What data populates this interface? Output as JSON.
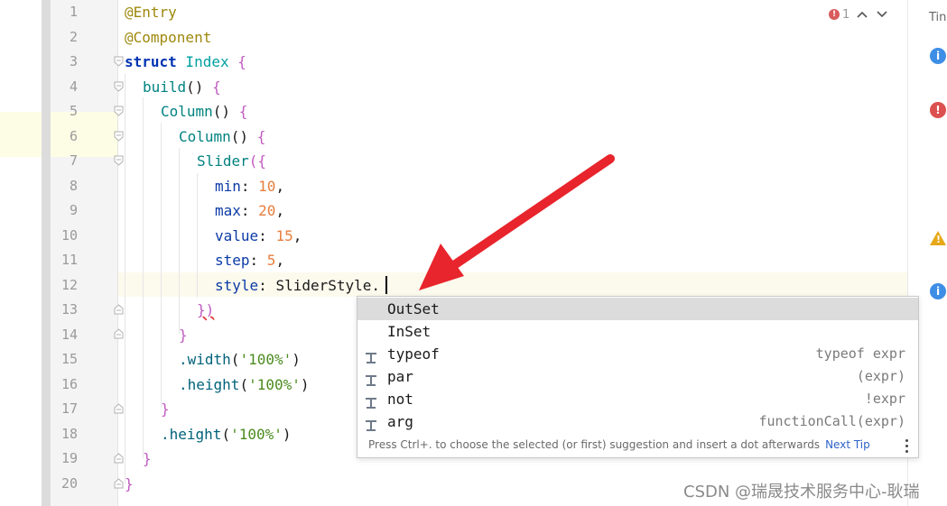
{
  "editor": {
    "lines": [
      {
        "n": "1"
      },
      {
        "n": "2"
      },
      {
        "n": "3"
      },
      {
        "n": "4"
      },
      {
        "n": "5"
      },
      {
        "n": "6"
      },
      {
        "n": "7"
      },
      {
        "n": "8"
      },
      {
        "n": "9"
      },
      {
        "n": "10"
      },
      {
        "n": "11"
      },
      {
        "n": "12"
      },
      {
        "n": "13"
      },
      {
        "n": "14"
      },
      {
        "n": "15"
      },
      {
        "n": "16"
      },
      {
        "n": "17"
      },
      {
        "n": "18"
      },
      {
        "n": "19"
      },
      {
        "n": "20"
      }
    ],
    "code": {
      "l1": "@Entry",
      "l2": "@Component",
      "l3_kw": "struct",
      "l3_name": " Index ",
      "l3_b": "{",
      "l4_fn": "build",
      "l4_rest": "() ",
      "l4_b": "{",
      "l5_fn": "Column",
      "l5_rest": "() ",
      "l5_b": "{",
      "l6_fn": "Column",
      "l6_rest": "() ",
      "l6_b": "{",
      "l7_fn": "Slider",
      "l7_rest": "({",
      "l8_k": "min",
      "l8_c": ": ",
      "l8_v": "10",
      "l8_t": ",",
      "l9_k": "max",
      "l9_c": ": ",
      "l9_v": "20",
      "l9_t": ",",
      "l10_k": "value",
      "l10_c": ": ",
      "l10_v": "15",
      "l10_t": ",",
      "l11_k": "step",
      "l11_c": ": ",
      "l11_v": "5",
      "l11_t": ",",
      "l12_k": "style",
      "l12_c": ": ",
      "l12_v": "SliderStyle.",
      "l13": "})",
      "l14": "}",
      "l15_m": ".width",
      "l15_o": "(",
      "l15_s": "'100%'",
      "l15_c": ")",
      "l16_m": ".height",
      "l16_o": "(",
      "l16_s": "'100%'",
      "l16_c": ")",
      "l17": "}",
      "l18_m": ".height",
      "l18_o": "(",
      "l18_s": "'100%'",
      "l18_c": ")",
      "l19": "}",
      "l20": "}"
    }
  },
  "inspection": {
    "error_count": "1",
    "up_icon": "chevron-up-icon",
    "down_icon": "chevron-down-icon"
  },
  "completion": {
    "items": [
      {
        "label": "OutSet",
        "tail": "",
        "icon": "none"
      },
      {
        "label": "InSet",
        "tail": "",
        "icon": "none"
      },
      {
        "label": "typeof",
        "tail": "typeof expr",
        "icon": "template-icon"
      },
      {
        "label": "par",
        "tail": "(expr)",
        "icon": "template-icon"
      },
      {
        "label": "not",
        "tail": "!expr",
        "icon": "template-icon"
      },
      {
        "label": "arg",
        "tail": "functionCall(expr)",
        "icon": "template-icon"
      }
    ],
    "hint": "Press Ctrl+. to choose the selected (or first) suggestion and insert a dot afterwards",
    "next_tip": "Next Tip"
  },
  "right_panel": {
    "tab_label": "Tin",
    "icons": [
      "info-icon",
      "error-icon",
      "warning-icon",
      "info-icon"
    ]
  },
  "watermark": "CSDN @瑞晟技术服务中心-耿瑞",
  "colors": {
    "annotation": "#9e880d",
    "keyword": "#0033b3",
    "number": "#e87d3e",
    "string": "#4b8b1f",
    "arrow": "#e8242c",
    "selection": "#dcdcdc"
  }
}
